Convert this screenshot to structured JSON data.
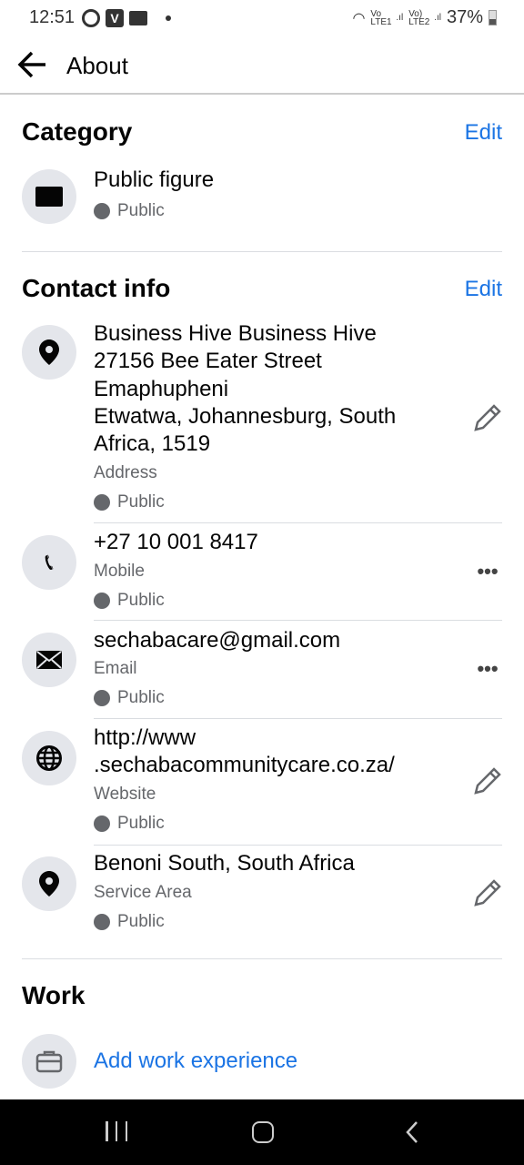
{
  "status_bar": {
    "time": "12:51",
    "signal1": "Vo LTE1",
    "signal2": "Vo) LTE2",
    "battery": "37%"
  },
  "header": {
    "title": "About"
  },
  "category": {
    "heading": "Category",
    "edit": "Edit",
    "value": "Public figure",
    "privacy": "Public"
  },
  "contact": {
    "heading": "Contact info",
    "edit": "Edit",
    "address": {
      "lines": [
        "Business Hive Business Hive",
        "27156 Bee Eater Street",
        "Emaphupheni",
        "Etwatwa, Johannesburg, South",
        "Africa, 1519"
      ],
      "label": "Address",
      "privacy": "Public"
    },
    "phone": {
      "value": "+27 10 001 8417",
      "label": "Mobile",
      "privacy": "Public"
    },
    "email": {
      "value": "sechabacare@gmail.com",
      "label": "Email",
      "privacy": "Public"
    },
    "website": {
      "lines": [
        "http://www",
        ".sechabacommunitycare.co.za/"
      ],
      "label": "Website",
      "privacy": "Public"
    },
    "service_area": {
      "value": "Benoni South, South Africa",
      "label": "Service Area",
      "privacy": "Public"
    }
  },
  "work": {
    "heading": "Work",
    "add": "Add work experience"
  },
  "colors": {
    "accent": "#1b74e4",
    "secondary": "#65676b"
  }
}
